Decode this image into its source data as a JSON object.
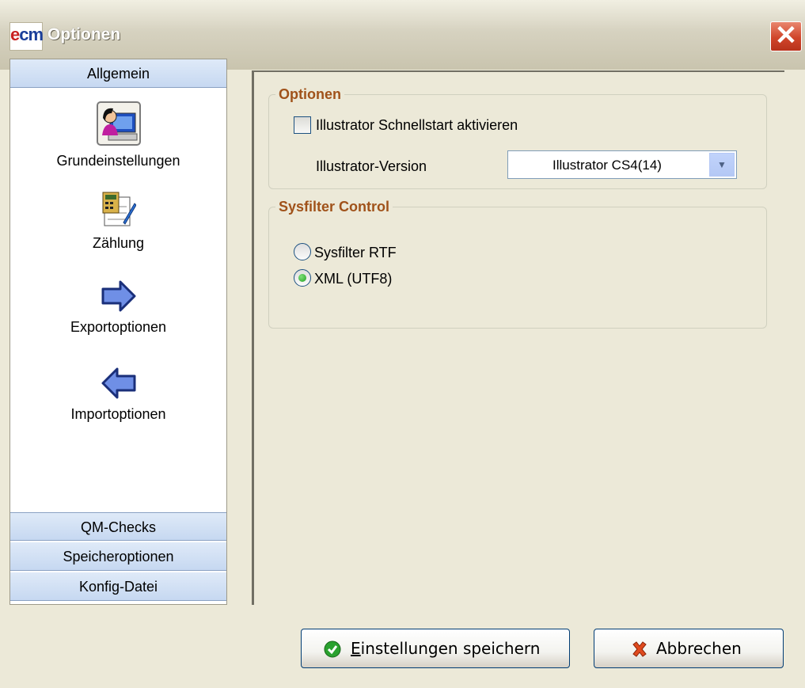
{
  "window": {
    "logo": "ecm",
    "title": "Optionen",
    "close_glyph": "✕"
  },
  "sidebar": {
    "header_top": "Allgemein",
    "items": [
      {
        "label": "Grundeinstellungen",
        "icon": "user-computer-icon"
      },
      {
        "label": "Zählung",
        "icon": "calculator-notepad-icon"
      },
      {
        "label": "Exportoptionen",
        "icon": "export-arrow-icon"
      },
      {
        "label": "Importoptionen",
        "icon": "import-arrow-icon"
      }
    ],
    "bottom_headers": [
      "QM-Checks",
      "Speicheroptionen",
      "Konfig-Datei"
    ]
  },
  "options_group": {
    "legend": "Optionen",
    "checkbox_label": "Illustrator Schnellstart aktivieren",
    "checkbox_checked": false,
    "version_label": "Illustrator-Version",
    "version_value": "Illustrator CS4(14)"
  },
  "sysfilter_group": {
    "legend": "Sysfilter Control",
    "radio_options": [
      {
        "label": "Sysfilter RTF",
        "checked": false
      },
      {
        "label": "XML (UTF8)",
        "checked": true
      }
    ]
  },
  "buttons": {
    "save_mnemonic": "E",
    "save_rest": "instellungen speichern",
    "cancel_label": "Abbrechen"
  },
  "colors": {
    "legend": "#a0521a",
    "category_header": "#c6d8f1",
    "radio_dot": "#21a121"
  }
}
